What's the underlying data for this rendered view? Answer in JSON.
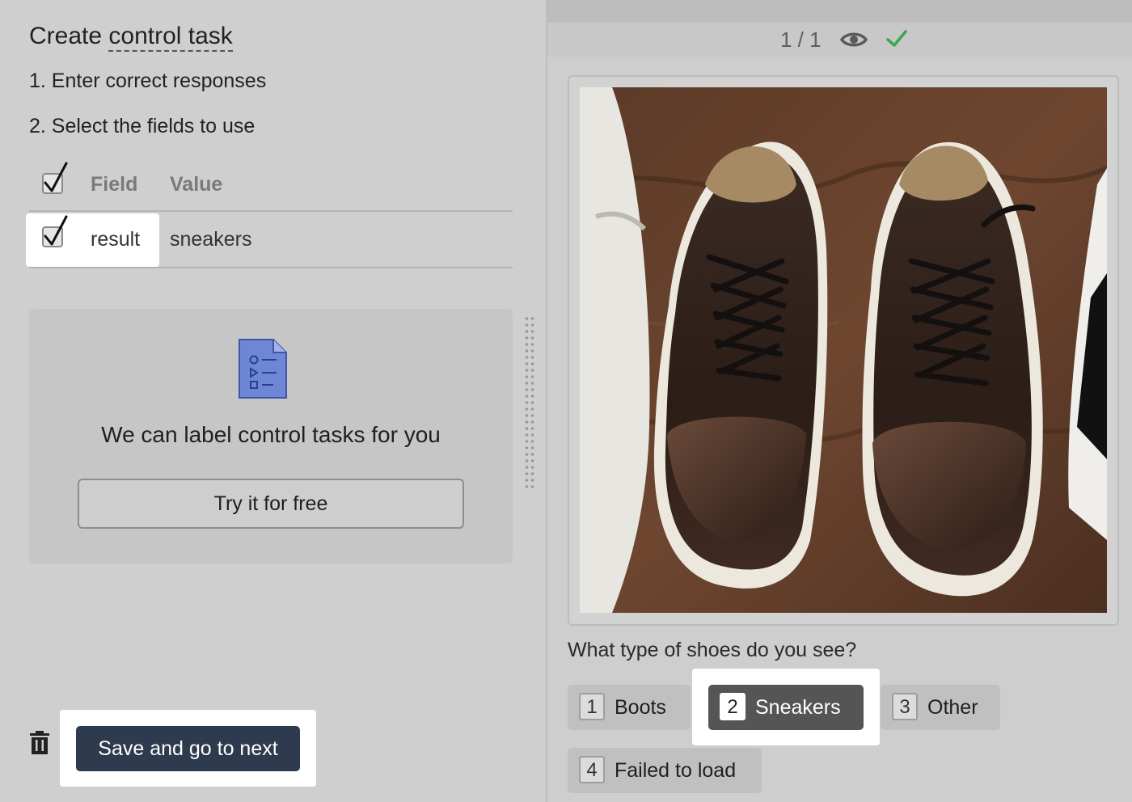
{
  "left_panel": {
    "title_prefix": "Create ",
    "title_link": "control task",
    "step1": "1. Enter correct responses",
    "step2": "2. Select the fields to use",
    "table": {
      "header": {
        "checked": true,
        "field_label": "Field",
        "value_label": "Value"
      },
      "rows": [
        {
          "checked": true,
          "field": "result",
          "value": "sneakers"
        }
      ]
    },
    "promo": {
      "icon": "document-checklist-icon",
      "text": "We can label control tasks for you",
      "button_label": "Try it for free"
    },
    "footer": {
      "delete_icon": "trash-icon",
      "save_label": "Save and go to next"
    }
  },
  "right_panel": {
    "pager": "1 / 1",
    "preview_icon": "eye-icon",
    "status_icon": "checkmark-icon",
    "accent_green": "#3aa84a",
    "image_alt": "pair of brown leather sneakers",
    "question": "What type of shoes do you see?",
    "options": [
      {
        "key": "1",
        "label": "Boots",
        "selected": false
      },
      {
        "key": "2",
        "label": "Sneakers",
        "selected": true
      },
      {
        "key": "3",
        "label": "Other",
        "selected": false
      },
      {
        "key": "4",
        "label": "Failed to load",
        "selected": false
      }
    ]
  },
  "colors": {
    "primary_button": "#2e3a4e",
    "selected_option": "#555555",
    "background": "#cfcfcf"
  }
}
